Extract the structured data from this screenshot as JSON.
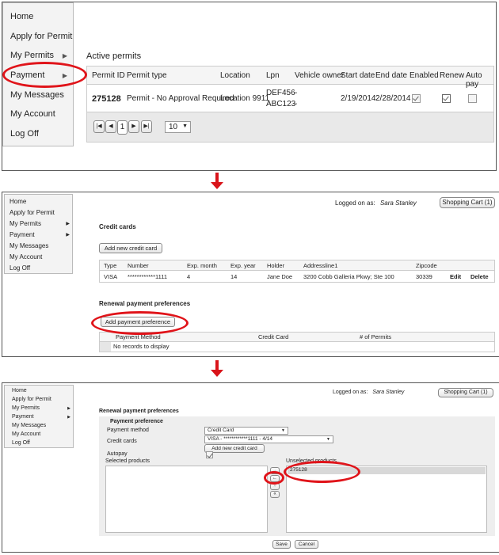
{
  "menu": {
    "items": [
      "Home",
      "Apply for Permit",
      "My Permits",
      "Payment",
      "My Messages",
      "My Account",
      "Log Off"
    ]
  },
  "screen1": {
    "section_title": "Active permits",
    "headers": [
      "Permit ID",
      "Permit type",
      "Location",
      "Lpn",
      "Vehicle owner",
      "Start date",
      "End date",
      "Enabled",
      "Renew",
      "Auto pay"
    ],
    "row": {
      "permit_id": "275128",
      "permit_type": "Permit - No Approval Required",
      "location": "Location 9911",
      "lpn_1": "DEF456",
      "lpn_2": "ABC123",
      "owner_1": "-",
      "owner_2": "-",
      "start_date": "2/19/2014",
      "end_date": "2/28/2014"
    },
    "pager": {
      "page": "1",
      "page_size": "10",
      "first": "|◀",
      "prev": "◀",
      "next": "▶",
      "last": "▶|",
      "caret": "▼"
    }
  },
  "screen2": {
    "logged_label": "Logged on as:",
    "user": "Sara Stanley",
    "cart": "Shopping Cart (1)",
    "credit_title": "Credit cards",
    "add_card": "Add new credit card",
    "card_headers": [
      "Type",
      "Number",
      "Exp. month",
      "Exp. year",
      "Holder",
      "Addressline1",
      "Zipcode"
    ],
    "card_row": {
      "type": "VISA",
      "number": "************1111",
      "exp_month": "4",
      "exp_year": "14",
      "holder": "Jane Doe",
      "address": "3200 Cobb Galleria Pkwy; Ste 100",
      "zip": "30339",
      "edit": "Edit",
      "delete": "Delete"
    },
    "renewal_title": "Renewal payment preferences",
    "add_pref": "Add payment preference",
    "pref_headers": [
      "Payment Method",
      "Credit Card",
      "# of Permits"
    ],
    "empty": "No records to display"
  },
  "screen3": {
    "logged_label": "Logged on as:",
    "user": "Sara Stanley",
    "cart": "Shopping Cart (1)",
    "renewal_title": "Renewal payment preferences",
    "pref_title": "Payment preference",
    "method_label": "Payment method",
    "method_value": "Credit Card",
    "cards_label": "Credit cards",
    "card_value": "VISA  -  ************1111  -  4/14",
    "add_card": "Add new credit card",
    "autopay_label": "Autopay",
    "selected_label": "Selected products",
    "unselected_label": "Unselected products",
    "unselected_items": [
      "275128"
    ],
    "move_buttons": [
      "→",
      "←",
      "»",
      "«"
    ],
    "save": "Save",
    "cancel": "Cancel",
    "caret": "▼"
  }
}
